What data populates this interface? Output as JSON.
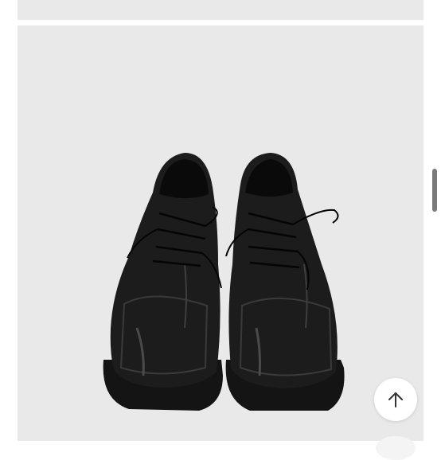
{
  "listing": {
    "previous_image": {
      "icon": "product-photo-icon"
    },
    "main_image": {
      "icon": "black-derby-shoes-photo-icon"
    }
  },
  "controls": {
    "scroll_top_icon": "arrow-up-icon"
  },
  "colors": {
    "card_background": "#e9e9ea",
    "page_background": "#ffffff",
    "scrollbar": "#7a7a7a",
    "shoe": "#111111"
  }
}
